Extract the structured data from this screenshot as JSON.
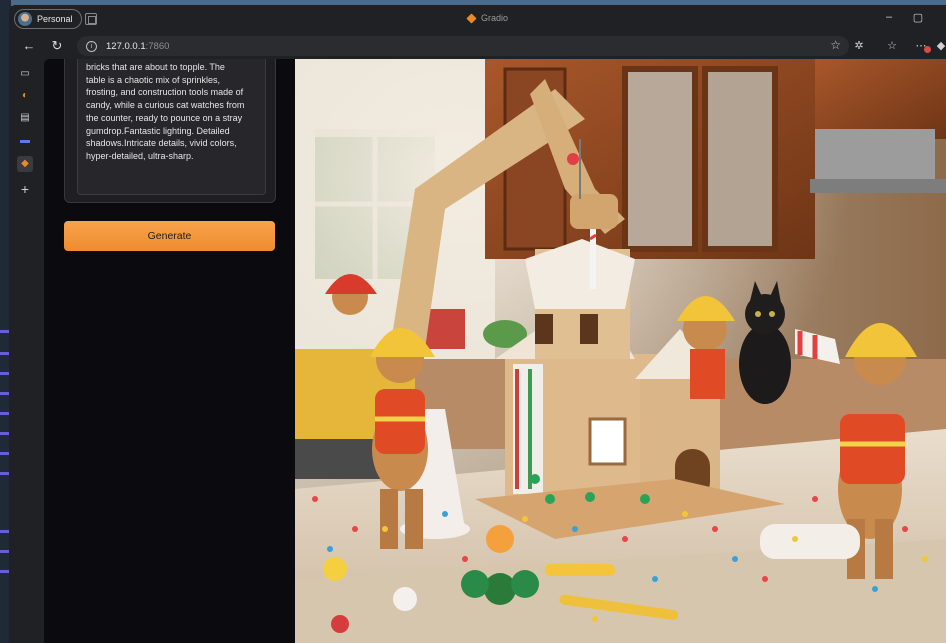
{
  "browser": {
    "profile_label": "Personal",
    "window_title": "Gradio",
    "url_host": "127.0.0.1",
    "url_port": ":7860"
  },
  "prompt": {
    "text": "gesturing at a pile of marshmallow\nbricks that are about to topple. The\ntable is a chaotic mix of sprinkles,\nfrosting, and construction tools made of\ncandy, while a curious cat watches from\nthe counter, ready to pounce on a stray\ngumdrop.Fantastic lighting. Detailed\nshadows.Intricate details, vivid colors,\nhyper-detailed, ultra-sharp."
  },
  "generate": {
    "label": "Generate"
  },
  "output_image": {
    "subject": "gingerbread house construction scene",
    "accent_color": "#f4a03c"
  },
  "colors": {
    "browser_bg": "#202124",
    "app_bg": "#0b0b0f",
    "button": "#f4993c"
  }
}
